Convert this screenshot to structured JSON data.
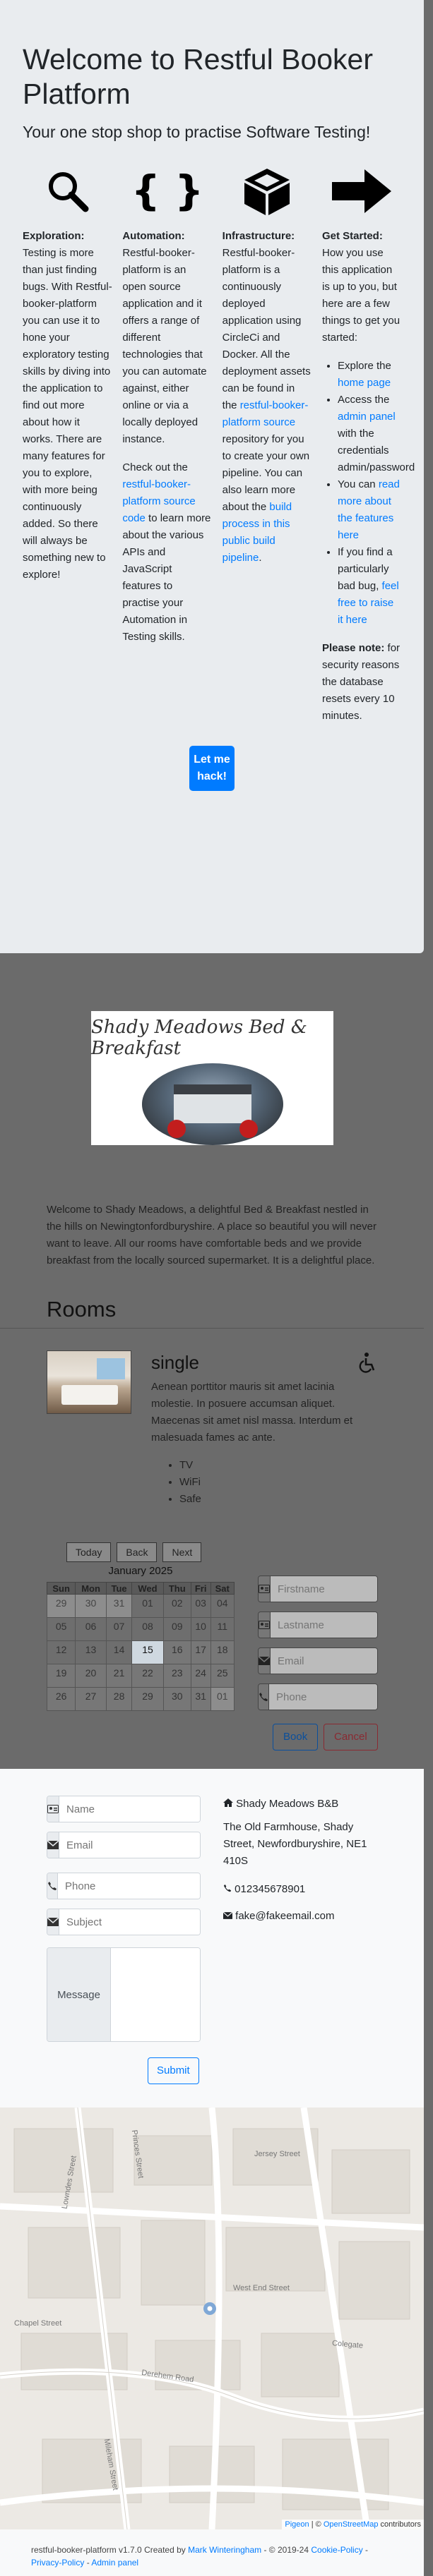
{
  "intro": {
    "title": "Welcome to Restful Booker Platform",
    "lead": "Your one stop shop to practise Software Testing!",
    "columns": {
      "exploration": {
        "heading": "Exploration:",
        "text": "Testing is more than just finding bugs. With Restful-booker-platform you can use it to hone your exploratory testing skills by diving into the application to find out more about how it works. There are many features for you to explore, with more being continuously added. So there will always be something new to explore!"
      },
      "automation": {
        "heading": "Automation:",
        "text": "Restful-booker-platform is an open source application and it offers a range of different technologies that you can automate against, either online or via a locally deployed instance.",
        "p2_before": "Check out the ",
        "p2_link": "restful-booker-platform source code",
        "p2_after": " to learn more about the various APIs and JavaScript features to practise your Automation in Testing skills."
      },
      "infrastructure": {
        "heading": "Infrastructure:",
        "text_before": "Restful-booker-platform is a continuously deployed application using CircleCi and Docker. All the deployment assets can be found in the ",
        "link1": "restful-booker-platform source",
        "text_mid": " repository for you to create your own pipeline. You can also learn more about the ",
        "link2": "build process in this public build pipeline",
        "text_after": "."
      },
      "started": {
        "heading": "Get Started:",
        "text": "How you use this application is up to you, but here are a few things to get you started:",
        "li1_before": "Explore the ",
        "li1_link": "home page",
        "li2_before": "Access the ",
        "li2_link": "admin panel",
        "li2_after": " with the credentials ",
        "li2_creds": "admin/password",
        "li3_before": "You can ",
        "li3_link": "read more about the features here",
        "li4_before": "If you find a particularly bad bug, ",
        "li4_link": "feel free to raise it here",
        "note_heading": "Please note:",
        "note_text": " for security reasons the database resets every 10 minutes."
      }
    },
    "button": "Let me hack!"
  },
  "logo": {
    "title": "Shady Meadows Bed & Breakfast"
  },
  "welcome_text": "Welcome to Shady Meadows, a delightful Bed & Breakfast nestled in the hills on Newingtonfordburyshire. A place so beautiful you will never want to leave. All our rooms have comfortable beds and we provide breakfast from the locally sourced supermarket. It is a delightful place.",
  "rooms": {
    "title": "Rooms",
    "room": {
      "type": "single",
      "description": "Aenean porttitor mauris sit amet lacinia molestie. In posuere accumsan aliquet. Maecenas sit amet nisl massa. Interdum et malesuada fames ac ante.",
      "features": [
        "TV",
        "WiFi",
        "Safe"
      ]
    }
  },
  "calendar": {
    "buttons": [
      "Today",
      "Back",
      "Next"
    ],
    "month": "January 2025",
    "weekdays": [
      "Sun",
      "Mon",
      "Tue",
      "Wed",
      "Thu",
      "Fri",
      "Sat"
    ],
    "weeks": [
      [
        "29",
        "30",
        "31",
        "01",
        "02",
        "03",
        "04"
      ],
      [
        "05",
        "06",
        "07",
        "08",
        "09",
        "10",
        "11"
      ],
      [
        "12",
        "13",
        "14",
        "15",
        "16",
        "17",
        "18"
      ],
      [
        "19",
        "20",
        "21",
        "22",
        "23",
        "24",
        "25"
      ],
      [
        "26",
        "27",
        "28",
        "29",
        "30",
        "31",
        "01"
      ]
    ],
    "today": "15"
  },
  "booking": {
    "firstname_placeholder": "Firstname",
    "lastname_placeholder": "Lastname",
    "email_placeholder": "Email",
    "phone_placeholder": "Phone",
    "book_label": "Book",
    "cancel_label": "Cancel",
    "book_color": "#007bff",
    "cancel_color": "#dc3545"
  },
  "contact": {
    "name_placeholder": "Name",
    "email_placeholder": "Email",
    "phone_placeholder": "Phone",
    "subject_placeholder": "Subject",
    "message_label": "Message",
    "submit_label": "Submit",
    "address": {
      "name": "Shady Meadows B&B",
      "line1": "The Old Farmhouse, Shady",
      "line2": "Street, Newfordburyshire, NE1",
      "line3": "410S",
      "phone": "012345678901",
      "email": "fake@fakeemail.com"
    }
  },
  "map": {
    "streets": [
      "Lowndes Street",
      "Princes Street",
      "Derehem Road",
      "West End Street",
      "Colegate",
      "Chapel Street",
      "Jersey Street",
      "Mileham Street"
    ],
    "attribution_1": "Pigeon",
    "attribution_sep": " | © ",
    "attribution_2": "OpenStreetMap",
    "attribution_3": " contributors"
  },
  "footer": {
    "text1": "restful-booker-platform v1.7.0 Created by ",
    "author": "Mark Winteringham",
    "text2": " - © 2019-24 ",
    "cookie": "Cookie-Policy",
    "dash": " - ",
    "privacy": "Privacy-Policy",
    "admin": "Admin panel"
  },
  "colors": {
    "accent": "#007bff",
    "overlay_bg": "#e9ecef",
    "backdrop": "#6b6b6b"
  }
}
